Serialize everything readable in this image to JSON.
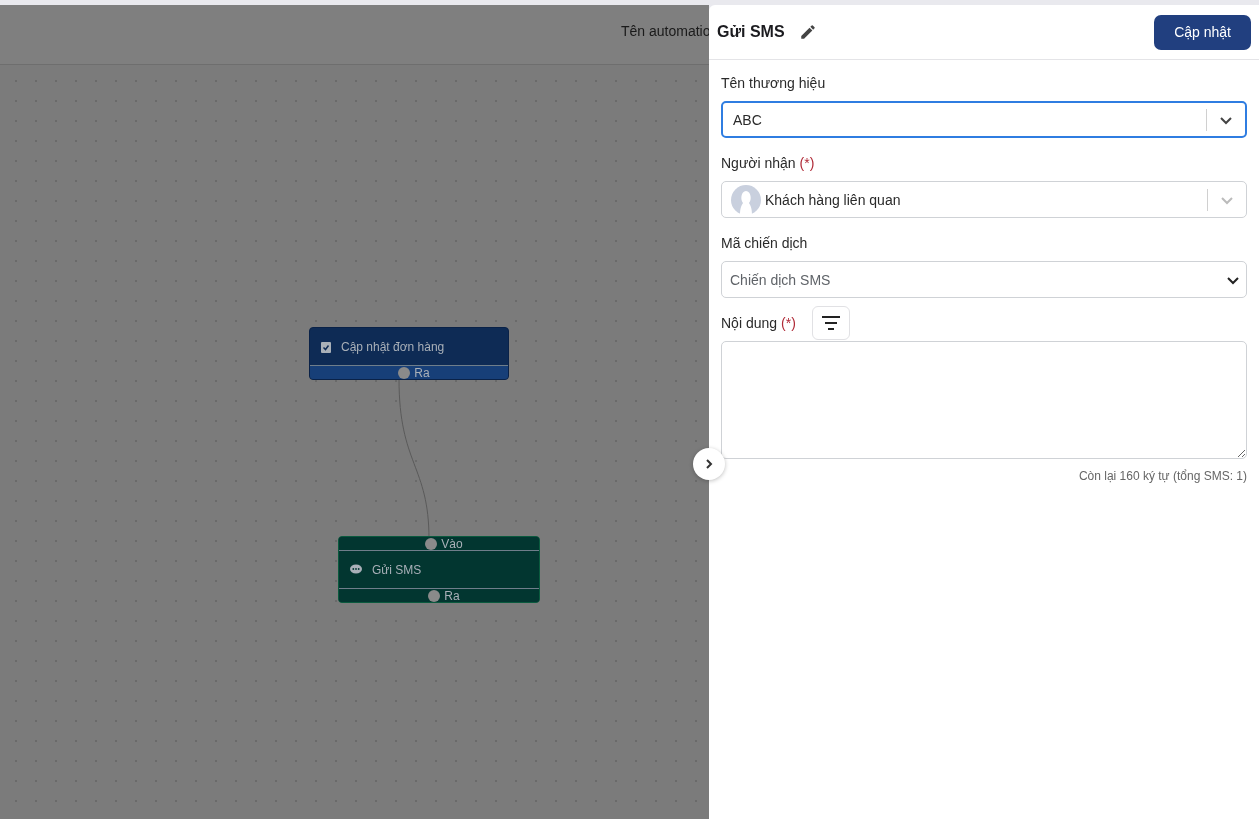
{
  "canvas": {
    "automation_label": "Tên automatio",
    "nodes": [
      {
        "kind": "action",
        "title": "Cập nhật đơn hàng",
        "ports": [
          {
            "kind": "out",
            "label": "Ra"
          }
        ]
      },
      {
        "kind": "sms",
        "title": "Gửi SMS",
        "ports": [
          {
            "kind": "in",
            "label": "Vào"
          },
          {
            "kind": "out",
            "label": "Ra"
          }
        ]
      }
    ]
  },
  "panel": {
    "title": "Gửi SMS",
    "save_button": "Cập nhật",
    "expanded": true,
    "fields": [
      {
        "kind": "select",
        "label": "Tên thương hiệu",
        "value": "ABC",
        "focused": true
      },
      {
        "kind": "avatar-select",
        "label": "Người nhận",
        "required_mark": "(*)",
        "value": "Khách hàng liên quan",
        "focused": false
      },
      {
        "kind": "native-select",
        "label": "Mã chiến dịch",
        "placeholder": "Chiến dịch SMS"
      },
      {
        "kind": "textarea",
        "label": "Nội dung",
        "required_mark": "(*)",
        "counter": "Còn lại 160 ký tự (tổng SMS: 1)"
      }
    ]
  }
}
